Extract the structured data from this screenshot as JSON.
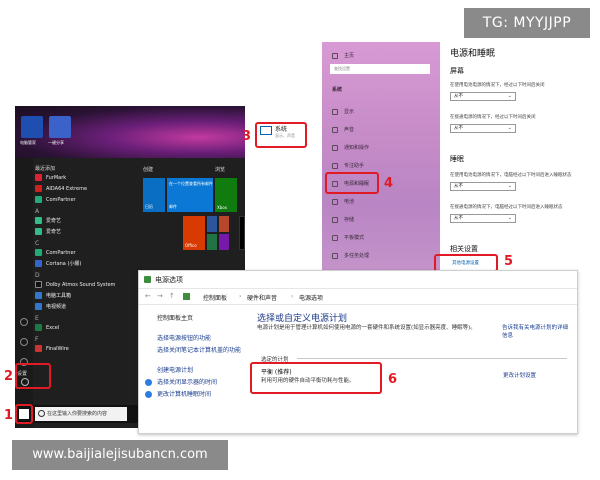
{
  "watermarks": {
    "top": "TG: MYYJJPP",
    "bottom": "www.baijialejisubancn.com"
  },
  "colors": {
    "accent_red": "#e01b24",
    "link_blue": "#1a3d8f",
    "settings_nav_pink": "#c68cc8"
  },
  "start_menu": {
    "tiles_top": [
      "电脑管家",
      "一键分享"
    ],
    "section_recent": "最近添加",
    "apps_recent": [
      "FurMark",
      "AIDA64 Extreme",
      "ComPartner"
    ],
    "letter_a": "A",
    "apps_a": [
      "爱奇艺",
      "爱奇艺"
    ],
    "letter_c": "C",
    "apps_c": [
      "ComPartner",
      "Cortana (小娜)"
    ],
    "letter_d": "D",
    "apps_d": [
      "Dolby Atmos Sound System",
      "电脑工具箱",
      "电视频道"
    ],
    "letter_e": "E",
    "apps_e": [
      "Excel"
    ],
    "letter_f": "F",
    "apps_f": [
      "FinalWire"
    ],
    "group_create": "创建",
    "group_browse": "浏览",
    "tiles": {
      "calendar": "日历",
      "mail": "邮件",
      "mail_header": "在一个位置查看所有邮件",
      "xbox": "Xbox",
      "office": "Office",
      "dolby": "DOLBY"
    },
    "rail_settings": "设置",
    "search_placeholder": "在这里输入你要搜索的内容"
  },
  "system_tile": {
    "title": "系统",
    "subtitle": "显示、声音"
  },
  "settings": {
    "nav_home": "主页",
    "nav_search_placeholder": "查找设置",
    "nav_section": "系统",
    "nav_items": [
      "显示",
      "声音",
      "通知和操作",
      "专注助手",
      "电源和睡眠",
      "电池",
      "存储",
      "平板模式",
      "多任务处理"
    ],
    "page_title": "电源和睡眠",
    "screen_heading": "屏幕",
    "screen_battery_desc": "在使用电池电源的情况下，经过以下时间后关闭",
    "screen_plugged_desc": "在接通电源的情况下，经过以下时间后关闭",
    "sleep_heading": "睡眠",
    "sleep_battery_desc": "在使用电池电源的情况下，电脑经过以下时间后进入睡眠状态",
    "sleep_plugged_desc": "在接通电源的情况下，电脑经过以下时间后进入睡眠状态",
    "dropdown_value": "从不",
    "related_heading": "相关设置",
    "related_link": "其他电源设置"
  },
  "control_panel": {
    "window_title": "电源选项",
    "breadcrumbs": [
      "控制面板",
      "硬件和声音",
      "电源选项"
    ],
    "side_home": "控制面板主页",
    "side_links": [
      "选择电源按钮的功能",
      "选择关闭笔记本计算机盖的功能",
      "创建电源计划",
      "选择关闭显示器的时间",
      "更改计算机睡眠时间"
    ],
    "main_title": "选择或自定义电源计划",
    "main_desc": "电源计划是用于管理计算机如何使用电源的一套硬件和系统设置(如显示器亮度、睡眠等)。",
    "main_desc_link": "告诉我有关电源计划的详细信息",
    "selected_plan_label": "选定的计划",
    "plan_name": "平衡 (推荐)",
    "plan_desc": "利用可用的硬件自动平衡功耗与性能。",
    "plan_edit_link": "更改计划设置"
  },
  "steps": [
    "1",
    "2",
    "3",
    "4",
    "5",
    "6"
  ]
}
